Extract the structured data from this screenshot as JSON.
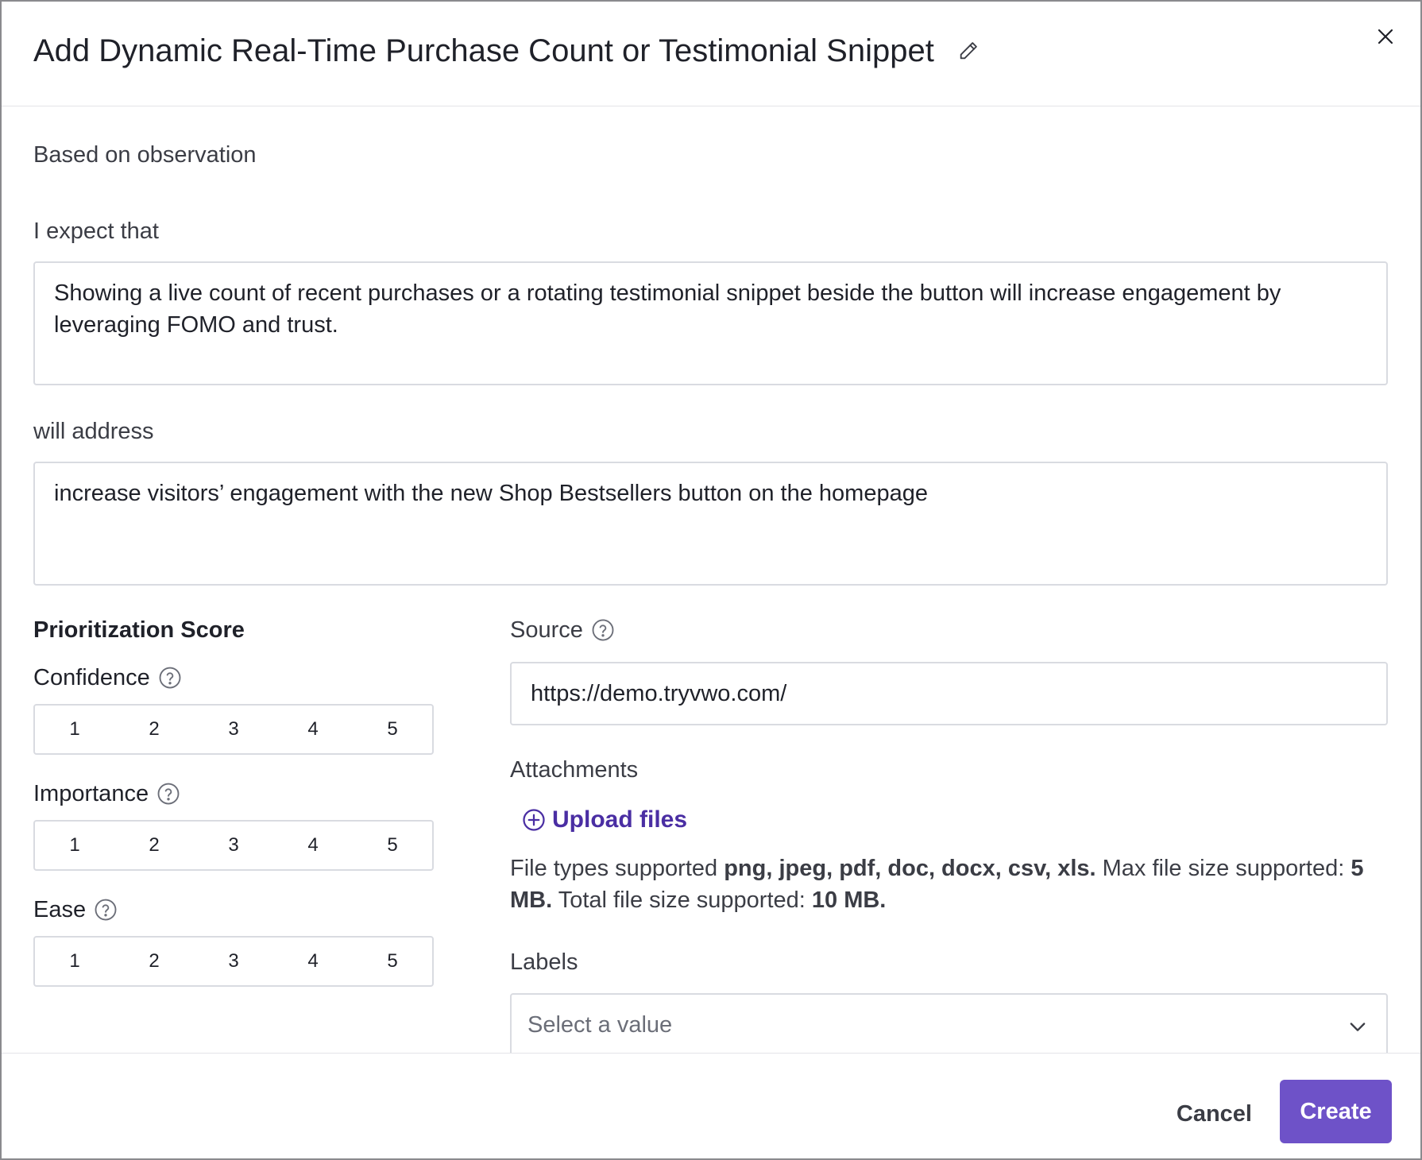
{
  "dialog": {
    "title": "Add Dynamic Real-Time Purchase Count or Testimonial Snippet"
  },
  "form": {
    "observation_label": "Based on observation",
    "expect_label": "I expect that",
    "expect_value": "Showing a live count of recent purchases or a rotating testimonial snippet beside the button will increase engagement by leveraging FOMO and trust.",
    "address_label": "will address",
    "address_value": "increase visitors’ engagement with the new Shop Bestsellers button on the homepage"
  },
  "prioritization": {
    "title": "Prioritization Score",
    "confidence_label": "Confidence",
    "importance_label": "Importance",
    "ease_label": "Ease",
    "options": [
      "1",
      "2",
      "3",
      "4",
      "5"
    ]
  },
  "source": {
    "label": "Source",
    "value": "https://demo.tryvwo.com/"
  },
  "attachments": {
    "label": "Attachments",
    "upload_label": "Upload files",
    "types_prefix": "File types supported ",
    "types_list": "png, jpeg, pdf, doc, docx, csv, xls.",
    "max_prefix": " Max file size supported: ",
    "max_value": "5 MB.",
    "total_prefix": " Total file size supported: ",
    "total_value": "10 MB."
  },
  "labels": {
    "label": "Labels",
    "placeholder": "Select a value"
  },
  "footer": {
    "cancel_label": "Cancel",
    "create_label": "Create"
  },
  "colors": {
    "accent": "#6e52c8",
    "link": "#4a2ea3",
    "border": "#d9dbe1"
  },
  "icons": {
    "edit": "pencil-icon",
    "close": "close-icon",
    "help": "help-circle-icon",
    "upload": "plus-circle-icon",
    "dropdown": "chevron-down-icon"
  }
}
